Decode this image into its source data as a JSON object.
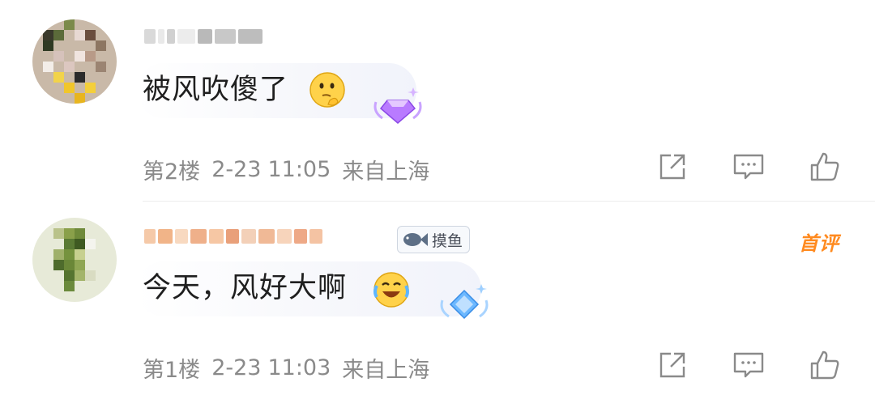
{
  "comments": [
    {
      "text": "被风吹傻了",
      "floor": "第2楼",
      "date": "2-23",
      "time": "11:05",
      "location": "来自上海",
      "emoji": "thinking-face-emoji",
      "badge": "purple-diamond-badge"
    },
    {
      "text": "今天，风好大啊",
      "floor": "第1楼",
      "date": "2-23",
      "time": "11:03",
      "location": "来自上海",
      "emoji": "laughing-tears-emoji",
      "badge": "blue-diamond-badge",
      "tag_label": "摸鱼",
      "top_label": "首评"
    }
  ],
  "actions": [
    "share-icon",
    "comment-icon",
    "like-icon"
  ],
  "colors": {
    "meta_text": "#8a8a8a",
    "first_badge": "#ff8a1f",
    "divider": "#ececec"
  }
}
